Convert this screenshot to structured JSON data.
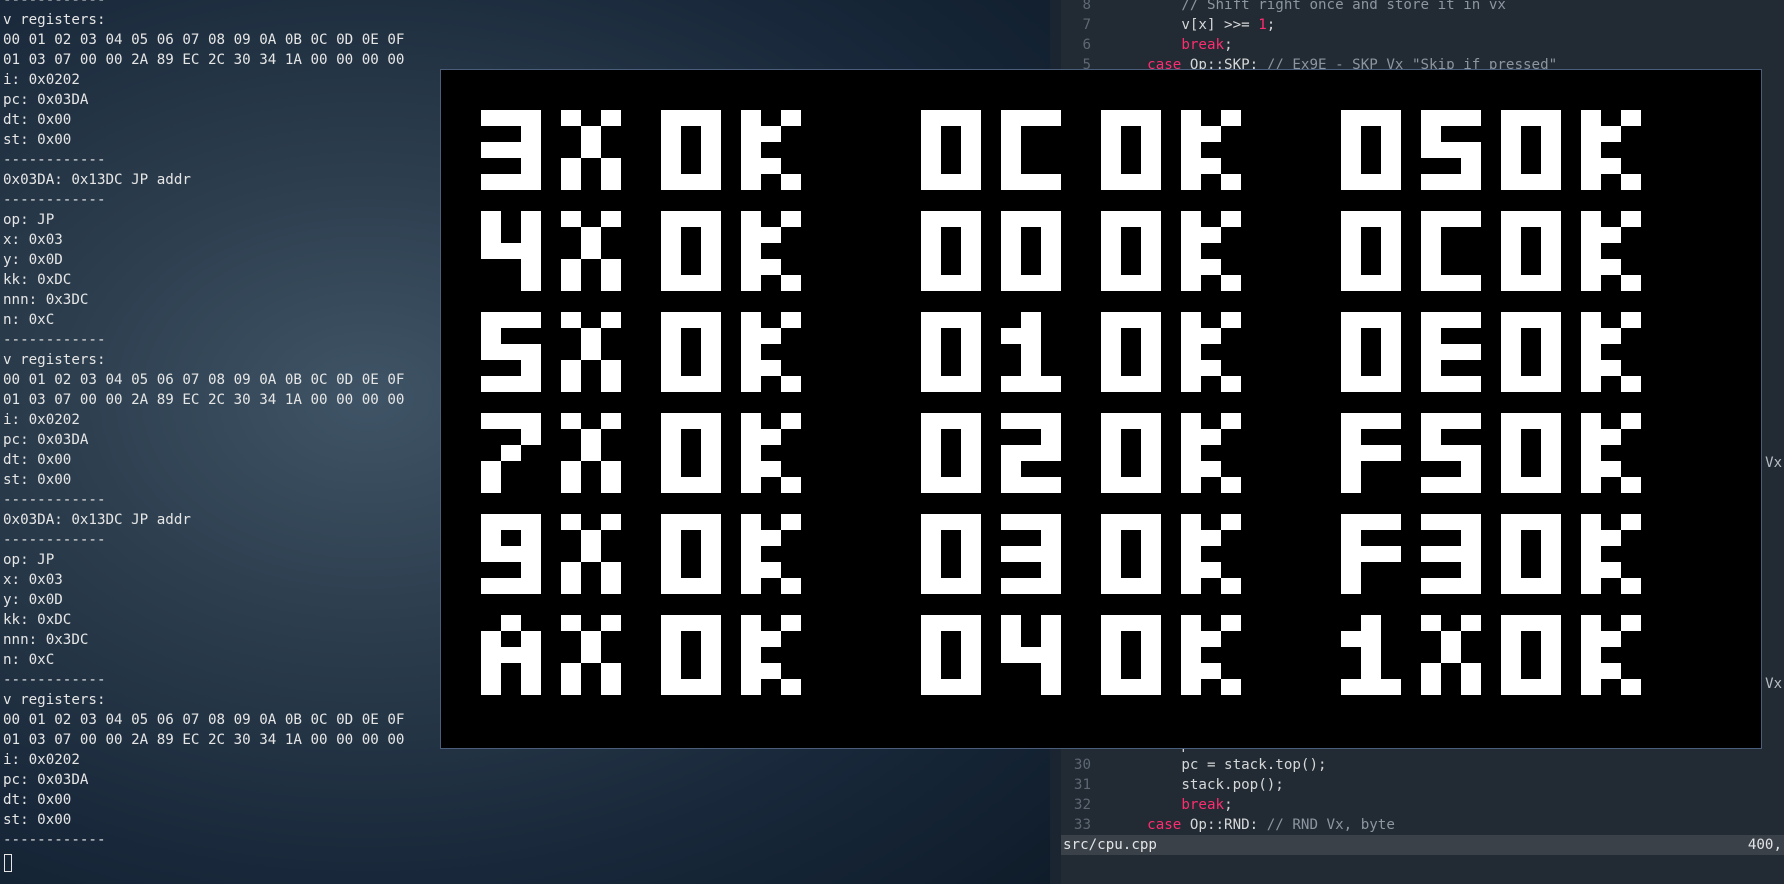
{
  "terminal": {
    "lines": [
      "------------",
      "v registers:",
      "00 01 02 03 04 05 06 07 08 09 0A 0B 0C 0D 0E 0F",
      "01 03 07 00 00 2A 89 EC 2C 30 34 1A 00 00 00 00",
      "i: 0x0202",
      "pc: 0x03DA",
      "dt: 0x00",
      "st: 0x00",
      "------------",
      "0x03DA: 0x13DC JP addr",
      "------------",
      "op: JP",
      "x: 0x03",
      "y: 0x0D",
      "kk: 0xDC",
      "nnn: 0x3DC",
      "n: 0xC",
      "------------",
      "v registers:",
      "00 01 02 03 04 05 06 07 08 09 0A 0B 0C 0D 0E 0F",
      "01 03 07 00 00 2A 89 EC 2C 30 34 1A 00 00 00 00",
      "i: 0x0202",
      "pc: 0x03DA",
      "dt: 0x00",
      "st: 0x00",
      "------------",
      "0x03DA: 0x13DC JP addr",
      "------------",
      "op: JP",
      "x: 0x03",
      "y: 0x0D",
      "kk: 0xDC",
      "nnn: 0x3DC",
      "n: 0xC",
      "------------",
      "v registers:",
      "00 01 02 03 04 05 06 07 08 09 0A 0B 0C 0D 0E 0F",
      "01 03 07 00 00 2A 89 EC 2C 30 34 1A 00 00 00 00",
      "i: 0x0202",
      "pc: 0x03DA",
      "dt: 0x00",
      "st: 0x00",
      "------------"
    ]
  },
  "editor": {
    "top_lines": [
      {
        "num": "8",
        "indent": "        ",
        "segments": [
          {
            "t": "// Shift right once and store it in vx",
            "c": "cm"
          }
        ]
      },
      {
        "num": "7",
        "indent": "        ",
        "segments": [
          {
            "t": "v[x] >>= ",
            "c": ""
          },
          {
            "t": "1",
            "c": "num"
          },
          {
            "t": ";",
            "c": ""
          }
        ]
      },
      {
        "num": "6",
        "indent": "        ",
        "segments": [
          {
            "t": "break",
            "c": "kw"
          },
          {
            "t": ";",
            "c": ""
          }
        ]
      },
      {
        "num": "5",
        "indent": "    ",
        "segments": [
          {
            "t": "case",
            "c": "kw"
          },
          {
            "t": " Op::SKP: ",
            "c": ""
          },
          {
            "t": "// Ex9E - SKP Vx \"Skip if pressed\"",
            "c": "cm"
          }
        ]
      }
    ],
    "bottom_lines": [
      {
        "num": "",
        "indent": "        ",
        "segments": [
          {
            "t": "p",
            "c": ""
          }
        ]
      },
      {
        "num": "30",
        "indent": "        ",
        "segments": [
          {
            "t": "pc = stack.top();",
            "c": ""
          }
        ]
      },
      {
        "num": "31",
        "indent": "        ",
        "segments": [
          {
            "t": "stack.pop();",
            "c": ""
          }
        ]
      },
      {
        "num": "32",
        "indent": "        ",
        "segments": [
          {
            "t": "break",
            "c": "kw"
          },
          {
            "t": ";",
            "c": ""
          }
        ]
      },
      {
        "num": "33",
        "indent": "    ",
        "segments": [
          {
            "t": "case",
            "c": "kw"
          },
          {
            "t": " Op::RND: ",
            "c": ""
          },
          {
            "t": "// RND Vx, byte",
            "c": "cm"
          }
        ]
      }
    ],
    "side_text_1": "Vx",
    "side_text_2": "Vx"
  },
  "statusbar": {
    "file": "src/cpu.cpp",
    "position": "400,"
  },
  "emulator": {
    "screen_rows": [
      [
        "3X",
        "OK",
        "0C",
        "OK",
        "0",
        "5",
        "OK"
      ],
      [
        "4X",
        "OK",
        "00",
        "OK",
        "0",
        "C",
        "OK"
      ],
      [
        "5X",
        "OK",
        "01",
        "OK",
        "0",
        "E",
        "OK"
      ],
      [
        "7X",
        "OK",
        "02",
        "OK",
        "F",
        "5",
        "OK"
      ],
      [
        "9X",
        "OK",
        "03",
        "OK",
        "F",
        "3",
        "OK"
      ],
      [
        "AX",
        "OK",
        "04",
        "OK",
        "1",
        "X",
        "OK"
      ]
    ]
  }
}
